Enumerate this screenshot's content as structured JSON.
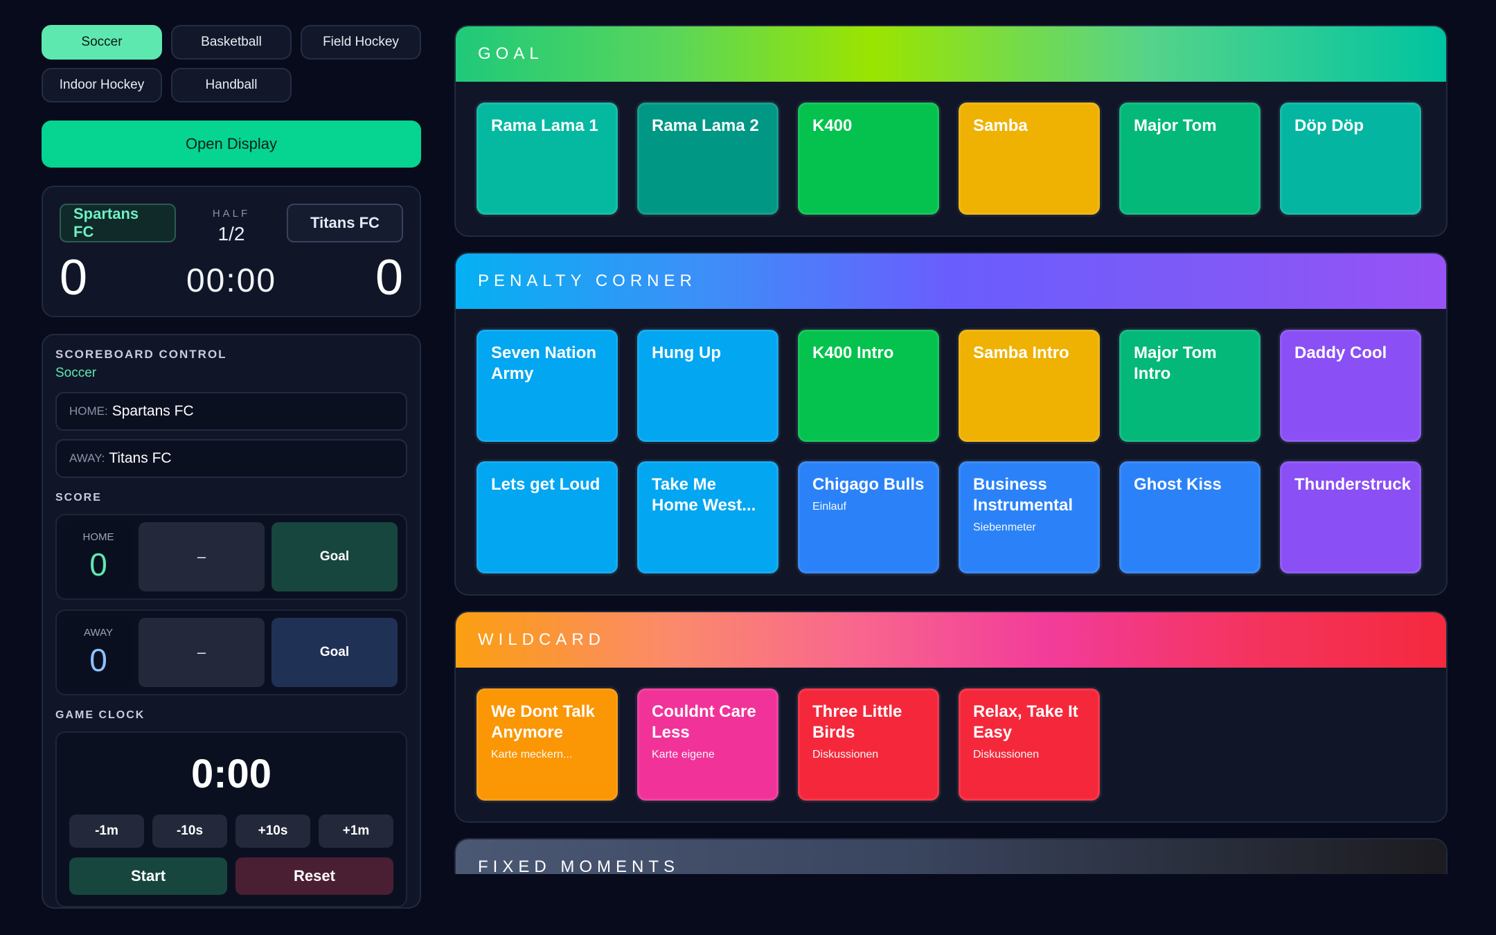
{
  "sports": [
    "Soccer",
    "Basketball",
    "Field Hockey",
    "Indoor Hockey",
    "Handball"
  ],
  "active_sport": "Soccer",
  "open_display_label": "Open Display",
  "scoreboard": {
    "home_team": "Spartans FC",
    "away_team": "Titans FC",
    "half_label": "HALF",
    "half_value": "1/2",
    "home_score": "0",
    "away_score": "0",
    "clock": "00:00"
  },
  "control": {
    "title": "SCOREBOARD CONTROL",
    "sport": "Soccer",
    "home_prefix": "HOME:",
    "home_value": "Spartans FC",
    "away_prefix": "AWAY:",
    "away_value": "Titans FC",
    "score_label": "SCORE",
    "home_label": "HOME",
    "home_score": "0",
    "away_label": "AWAY",
    "away_score": "0",
    "minus_label": "–",
    "goal_label": "Goal",
    "clock_label": "GAME CLOCK",
    "clock_value": "0:00",
    "adjust": [
      "-1m",
      "-10s",
      "+10s",
      "+1m"
    ],
    "start_label": "Start",
    "reset_label": "Reset"
  },
  "panels": [
    {
      "title": "GOAL",
      "header_class": "hdr-goal",
      "pads": [
        {
          "title": "Rama Lama 1",
          "sub": "",
          "color": "#05b9a0"
        },
        {
          "title": "Rama Lama 2",
          "sub": "",
          "color": "#009885"
        },
        {
          "title": "K400",
          "sub": "",
          "color": "#04c24d"
        },
        {
          "title": "Samba",
          "sub": "",
          "color": "#efb203"
        },
        {
          "title": "Major Tom",
          "sub": "",
          "color": "#03b879"
        },
        {
          "title": "Döp Döp",
          "sub": "",
          "color": "#04b6a1"
        }
      ]
    },
    {
      "title": "PENALTY CORNER",
      "header_class": "hdr-pc",
      "pads": [
        {
          "title": "Seven Nation Army",
          "sub": "",
          "color": "#02a6f1"
        },
        {
          "title": "Hung Up",
          "sub": "",
          "color": "#02a6f1"
        },
        {
          "title": "K400 Intro",
          "sub": "",
          "color": "#04c24d"
        },
        {
          "title": "Samba Intro",
          "sub": "",
          "color": "#efb203"
        },
        {
          "title": "Major Tom Intro",
          "sub": "",
          "color": "#03b879"
        },
        {
          "title": "Daddy Cool",
          "sub": "",
          "color": "#8a4ff5"
        },
        {
          "title": "Lets get Loud",
          "sub": "",
          "color": "#02a6f1"
        },
        {
          "title": "Take Me Home West...",
          "sub": "",
          "color": "#02a6f1"
        },
        {
          "title": "Chigago Bulls",
          "sub": "Einlauf",
          "color": "#2b82f8"
        },
        {
          "title": "Business Instrumental",
          "sub": "Siebenmeter",
          "color": "#2b82f8"
        },
        {
          "title": "Ghost Kiss",
          "sub": "",
          "color": "#2b82f8"
        },
        {
          "title": "Thunderstruck",
          "sub": "",
          "color": "#8a4ff5"
        }
      ]
    },
    {
      "title": "WILDCARD",
      "header_class": "hdr-wc",
      "pads": [
        {
          "title": "We Dont Talk Anymore",
          "sub": "Karte meckern...",
          "color": "#fb9604"
        },
        {
          "title": "Couldnt Care Less",
          "sub": "Karte eigene",
          "color": "#f13399"
        },
        {
          "title": "Three Little Birds",
          "sub": "Diskussionen",
          "color": "#f5283b"
        },
        {
          "title": "Relax, Take It Easy",
          "sub": "Diskussionen",
          "color": "#f5283b"
        }
      ]
    }
  ],
  "fixed_moments_title": "FIXED MOMENTS"
}
